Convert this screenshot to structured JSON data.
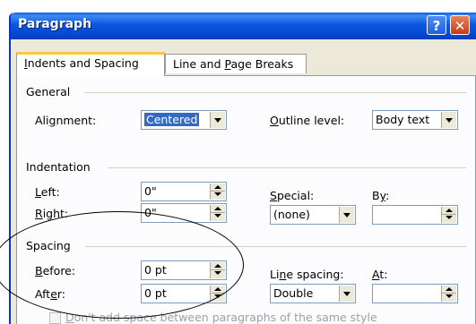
{
  "window": {
    "title": "Paragraph"
  },
  "titlebar": {
    "help_icon": "?",
    "close_icon": "✕"
  },
  "tabs": [
    {
      "pre": "",
      "u": "I",
      "post": "ndents and Spacing"
    },
    {
      "pre": "Line and ",
      "u": "P",
      "post": "age Breaks"
    }
  ],
  "general": {
    "heading": "General",
    "alignment": {
      "pre": "Ali",
      "u": "g",
      "post": "nment:",
      "value": "Centered"
    },
    "outline": {
      "pre": "",
      "u": "O",
      "post": "utline level:",
      "value": "Body text"
    }
  },
  "indentation": {
    "heading": "Indentation",
    "left": {
      "pre": "",
      "u": "L",
      "post": "eft:",
      "value": "0\""
    },
    "right": {
      "pre": "",
      "u": "R",
      "post": "ight:",
      "value": "0\""
    },
    "special": {
      "pre": "",
      "u": "S",
      "post": "pecial:",
      "value": "(none)"
    },
    "by": {
      "pre": "B",
      "u": "y",
      "post": ":",
      "value": ""
    }
  },
  "spacing": {
    "heading": "Spacing",
    "before": {
      "pre": "",
      "u": "B",
      "post": "efore:",
      "value": "0 pt"
    },
    "after": {
      "pre": "Aft",
      "u": "e",
      "post": "r:",
      "value": "0 pt"
    },
    "line_spacing": {
      "pre": "Li",
      "u": "n",
      "post": "e spacing:",
      "value": "Double"
    },
    "at": {
      "pre": "",
      "u": "A",
      "post": "t:",
      "value": ""
    },
    "dont_add": {
      "pre": "",
      "u": "D",
      "post": "on't add space between paragraphs of the same style"
    }
  }
}
